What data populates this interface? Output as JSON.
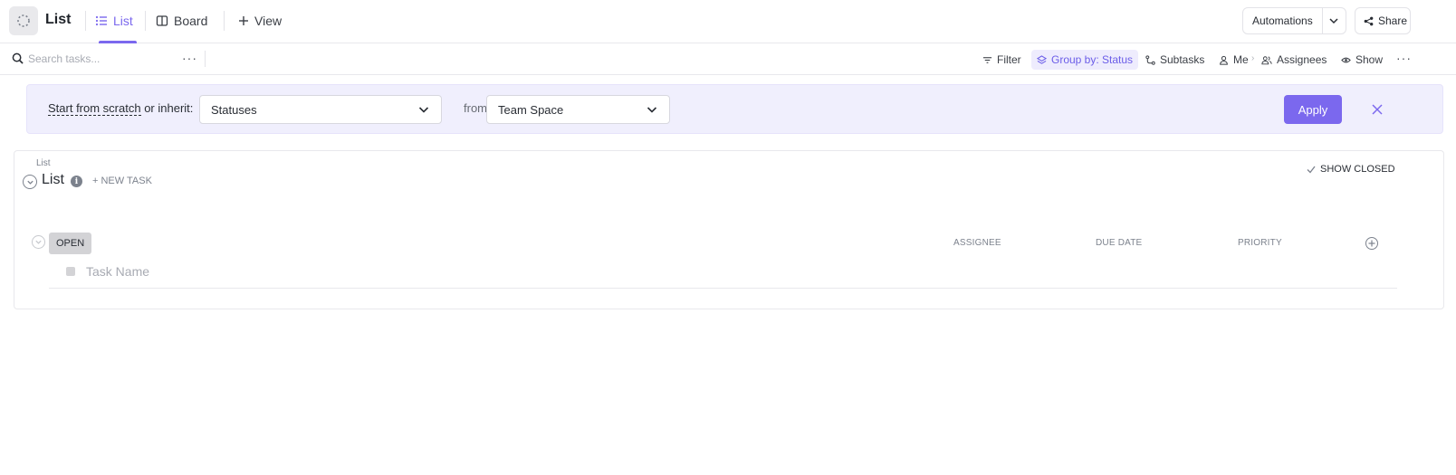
{
  "header": {
    "title": "List",
    "tabs": [
      {
        "label": "List",
        "icon": "list-icon",
        "active": true
      },
      {
        "label": "Board",
        "icon": "board-icon",
        "active": false
      }
    ],
    "add_view_label": "View",
    "automations_label": "Automations",
    "share_label": "Share",
    "accent_color": "#7b68ee"
  },
  "toolbar": {
    "search_placeholder": "Search tasks...",
    "more_label": "···",
    "filter_label": "Filter",
    "group_label": "Group by: Status",
    "subtasks_label": "Subtasks",
    "me_label": "Me",
    "assignees_label": "Assignees",
    "show_label": "Show",
    "more_right_label": "···"
  },
  "banner": {
    "label_prefix": "Start from scratch",
    "label_suffix": " or inherit:",
    "statuses_value": "Statuses",
    "from_label": "from",
    "space_value": "Team Space",
    "apply_label": "Apply"
  },
  "list": {
    "breadcrumb": "List",
    "title": "List",
    "info_glyph": "i",
    "new_task_label": "+ NEW TASK",
    "show_closed_label": "SHOW CLOSED",
    "group": {
      "status": "OPEN",
      "status_color": "#d3d3d6"
    },
    "columns": [
      "ASSIGNEE",
      "DUE DATE",
      "PRIORITY"
    ],
    "task_name_placeholder": "Task Name"
  }
}
